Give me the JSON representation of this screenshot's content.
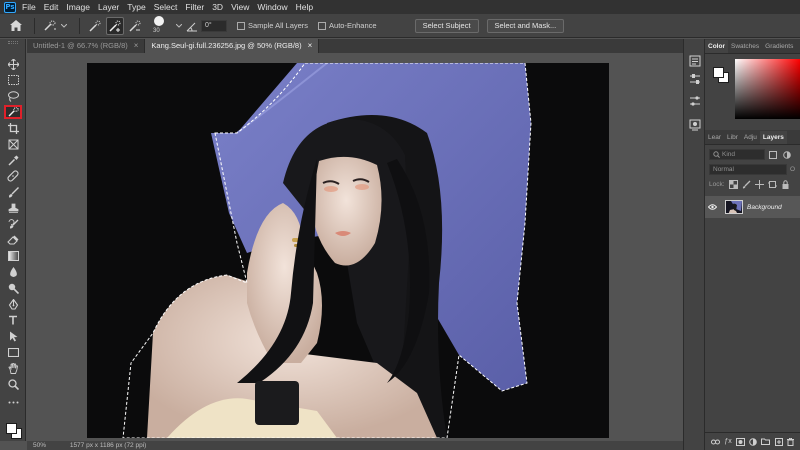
{
  "app": {
    "logo_text": "Ps"
  },
  "menu": [
    "File",
    "Edit",
    "Image",
    "Layer",
    "Type",
    "Select",
    "Filter",
    "3D",
    "View",
    "Window",
    "Help"
  ],
  "options_bar": {
    "brush_size": "30",
    "angle_value": "0°",
    "sample_all_layers_label": "Sample All Layers",
    "auto_enhance_label": "Auto-Enhance",
    "select_subject_label": "Select Subject",
    "select_and_mask_label": "Select and Mask..."
  },
  "document_tabs": [
    {
      "label": "Untitled-1 @ 66.7% (RGB/8)",
      "active": false
    },
    {
      "label": "Kang.Seul-gi.full.236256.jpg @ 50% (RGB/8)",
      "active": true
    }
  ],
  "status_bar": {
    "zoom": "50%",
    "info": "1577 px x 1186 px (72 ppi)"
  },
  "color_panel": {
    "tabs": [
      "Color",
      "Swatches",
      "Gradients"
    ],
    "active_tab": "Color",
    "foreground": "#ffffff",
    "background": "#ffffff"
  },
  "layers_panel": {
    "tabs": [
      "Lear",
      "Libr",
      "Adju",
      "Layers"
    ],
    "active_tab": "Layers",
    "search_placeholder": "Kind",
    "blend_mode": "Normal",
    "opacity_label": "O",
    "lock_label": "Lock:",
    "layers": [
      {
        "name": "Background",
        "visible": true
      }
    ]
  },
  "colors": {
    "active_tool_highlight": "#e0202a",
    "hat": "#6d72b8"
  }
}
